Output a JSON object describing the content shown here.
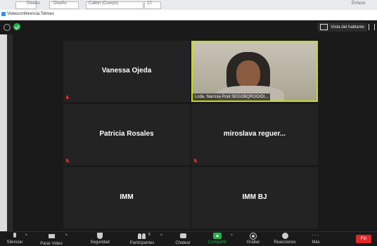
{
  "word_ribbon": {
    "font_name": "Calibri (Cuerpo)",
    "font_size": "12",
    "style1": "Diseño",
    "style2": "Énfasis"
  },
  "window": {
    "title": "Videoconferencia Telmex"
  },
  "topbar": {
    "view_label": "Vista del hablante"
  },
  "tiles": [
    {
      "name": "Vanessa Ojeda",
      "muted": true
    },
    {
      "name": "Lcda. Narcisa Pool SEGOBQROO/DI...",
      "video": true
    },
    {
      "name": "Patricia Rosales",
      "muted": true
    },
    {
      "name": "miroslava reguer...",
      "muted": true
    },
    {
      "name": "IMM",
      "muted": false
    },
    {
      "name": "IMM BJ",
      "muted": false
    }
  ],
  "toolbar": {
    "mute": "Silenciar",
    "video": "Parar Video",
    "security": "Seguridad",
    "participants": "Participantes",
    "participants_count": "8",
    "chat": "Chatear",
    "share": "Compartir",
    "record": "Grabar",
    "reactions": "Reacciones",
    "more": "Más",
    "end": "Fin"
  },
  "colors": {
    "active_speaker_border": "#c6e000",
    "share_green": "#23b14d",
    "end_red": "#e02828"
  }
}
